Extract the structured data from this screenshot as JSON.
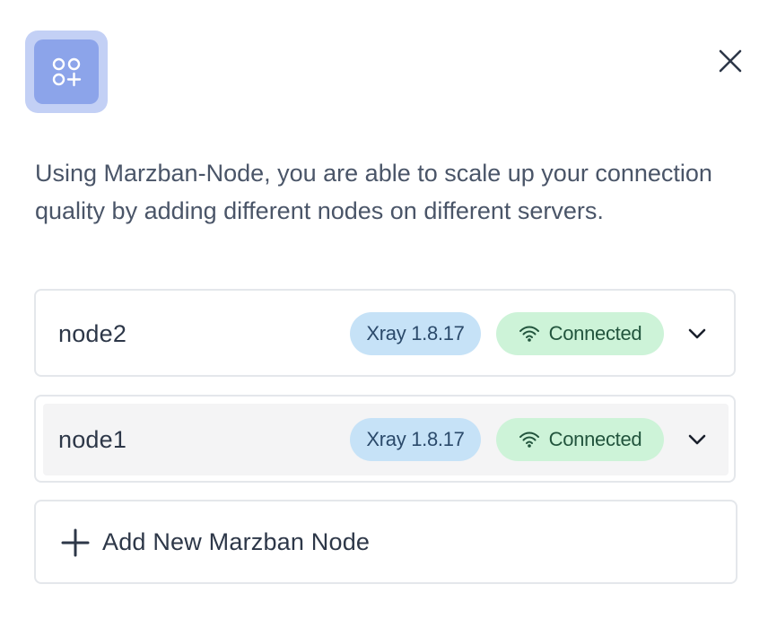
{
  "description": "Using Marzban-Node, you are able to scale up your connection quality by adding different nodes on different servers.",
  "nodes": [
    {
      "name": "node2",
      "version": "Xray 1.8.17",
      "status": "Connected",
      "hover": false
    },
    {
      "name": "node1",
      "version": "Xray 1.8.17",
      "status": "Connected",
      "hover": true
    }
  ],
  "add_button": {
    "label": "Add New Marzban Node"
  },
  "icons": {
    "header": "node-grid-plus-icon",
    "close": "close-icon",
    "status": "wifi-icon",
    "expand": "chevron-down-icon",
    "add": "plus-icon"
  },
  "colors": {
    "icon_bg_outer": "#c3d0f5",
    "icon_bg_inner": "#8ca4ea",
    "version_badge_bg": "#c6e2f7",
    "status_badge_bg": "#cdf3d8",
    "status_text": "#22543d"
  }
}
